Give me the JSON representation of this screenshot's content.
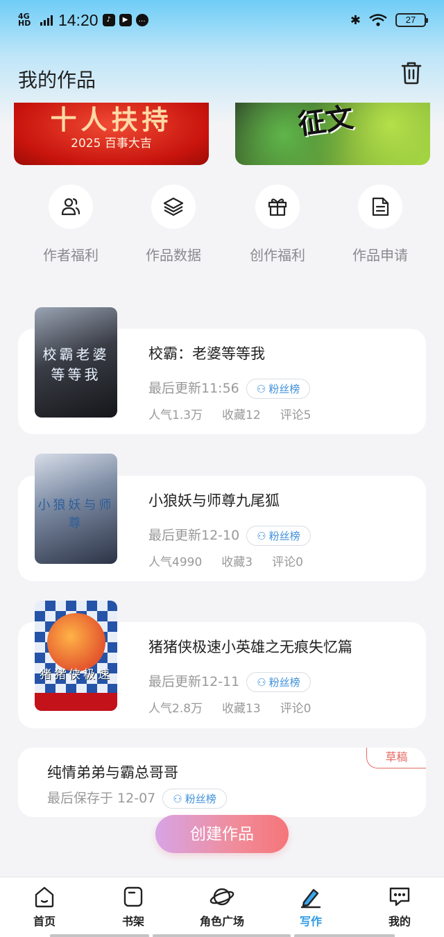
{
  "status_bar": {
    "network": "4G HD",
    "time": "14:20",
    "battery": "27"
  },
  "header": {
    "title": "我的作品"
  },
  "banners": [
    {
      "main_text": "十人扶持",
      "sub_text": "2025 百事大吉"
    },
    {
      "main_text": "征文"
    }
  ],
  "quick_entries": [
    {
      "label": "作者福利",
      "icon": "users-icon"
    },
    {
      "label": "作品数据",
      "icon": "layers-icon"
    },
    {
      "label": "创作福利",
      "icon": "gift-icon"
    },
    {
      "label": "作品申请",
      "icon": "document-icon"
    }
  ],
  "works": [
    {
      "title": "校霸：老婆等等我",
      "updated": "最后更新11:56",
      "fan_badge": "粉丝榜",
      "popularity": "人气1.3万",
      "favorites": "收藏12",
      "comments": "评论5",
      "cover_text": "校霸老婆等等我"
    },
    {
      "title": "小狼妖与师尊九尾狐",
      "updated": "最后更新12-10",
      "fan_badge": "粉丝榜",
      "popularity": "人气4990",
      "favorites": "收藏3",
      "comments": "评论0",
      "cover_text": "小狼妖与师尊"
    },
    {
      "title": "猪猪侠极速小英雄之无痕失忆篇",
      "updated": "最后更新12-11",
      "fan_badge": "粉丝榜",
      "popularity": "人气2.8万",
      "favorites": "收藏13",
      "comments": "评论0",
      "cover_text": "猪猪侠极速"
    }
  ],
  "draft": {
    "title": "纯情弟弟与霸总哥哥",
    "saved": "最后保存于 12-07",
    "fan_badge": "粉丝榜",
    "tag": "草稿"
  },
  "create_button": "创建作品",
  "bottom_nav": [
    {
      "label": "首页",
      "icon": "home-icon",
      "active": false
    },
    {
      "label": "书架",
      "icon": "bookshelf-icon",
      "active": false
    },
    {
      "label": "角色广场",
      "icon": "planet-icon",
      "active": false
    },
    {
      "label": "写作",
      "icon": "write-icon",
      "active": true
    },
    {
      "label": "我的",
      "icon": "message-icon",
      "active": false
    }
  ],
  "colors": {
    "accent": "#2b9be6",
    "draft_tag": "#e46a61",
    "fan_badge_text": "#3d8fd9"
  }
}
